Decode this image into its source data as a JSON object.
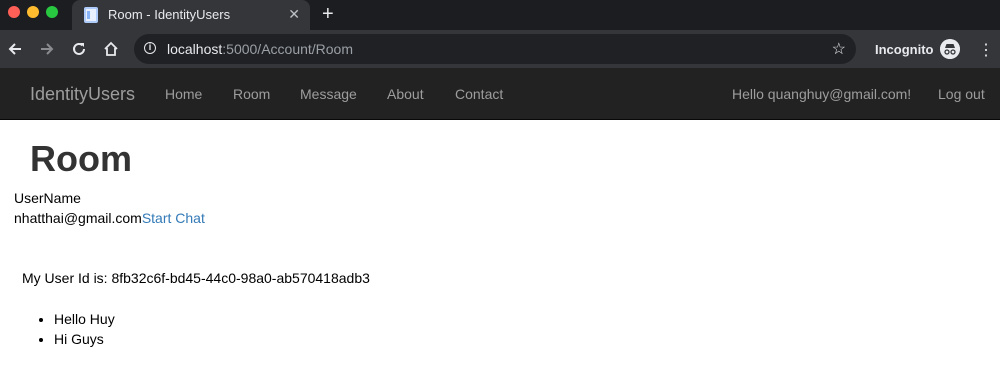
{
  "browser": {
    "tab_title": "Room - IdentityUsers",
    "url_host": "localhost",
    "url_rest": ":5000/Account/Room",
    "incognito_label": "Incognito",
    "colors": {
      "tabbar": "#1c1d20",
      "toolbar": "#35363a",
      "omnibox": "#202124"
    }
  },
  "navbar": {
    "brand": "IdentityUsers",
    "links": [
      "Home",
      "Room",
      "Message",
      "About",
      "Contact"
    ],
    "greeting": "Hello quanghuy@gmail.com!",
    "logout": "Log out",
    "colors": {
      "background": "#222222",
      "text": "#9d9d9d"
    }
  },
  "page": {
    "title": "Room",
    "table_header": "UserName",
    "users": [
      {
        "username": "nhatthai@gmail.com",
        "action": "Start Chat"
      }
    ],
    "user_id_text": "My User Id is: 8fb32c6f-bd45-44c0-98a0-ab570418adb3",
    "messages": [
      "Hello Huy",
      "Hi Guys"
    ],
    "link_color": "#337ab7"
  }
}
